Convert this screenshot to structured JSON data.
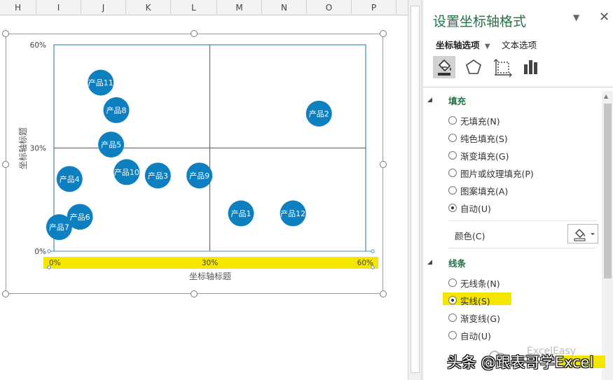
{
  "sheet": {
    "columns": [
      "H",
      "I",
      "J",
      "K",
      "L",
      "M",
      "N",
      "O",
      "P"
    ]
  },
  "chart_data": {
    "type": "bubble",
    "title": "",
    "xlabel": "坐标轴标题",
    "ylabel": "坐标轴标题",
    "xlim": [
      0,
      0.6
    ],
    "ylim": [
      0,
      0.6
    ],
    "x_ticks": [
      "0%",
      "30%",
      "60%"
    ],
    "y_ticks": [
      "0%",
      "30%",
      "60%"
    ],
    "grid": true,
    "legend": "none",
    "bubble_color": "#0e7fbf",
    "highlight_color": "#f5e600",
    "points": [
      {
        "label": "产品11",
        "x": 0.09,
        "y": 0.49
      },
      {
        "label": "产品8",
        "x": 0.12,
        "y": 0.41
      },
      {
        "label": "产品2",
        "x": 0.51,
        "y": 0.4
      },
      {
        "label": "产品5",
        "x": 0.11,
        "y": 0.31
      },
      {
        "label": "产品10",
        "x": 0.14,
        "y": 0.23
      },
      {
        "label": "产品3",
        "x": 0.2,
        "y": 0.22
      },
      {
        "label": "产品9",
        "x": 0.28,
        "y": 0.22
      },
      {
        "label": "产品4",
        "x": 0.03,
        "y": 0.21
      },
      {
        "label": "产品6",
        "x": 0.05,
        "y": 0.1
      },
      {
        "label": "产品1",
        "x": 0.36,
        "y": 0.11
      },
      {
        "label": "产品12",
        "x": 0.46,
        "y": 0.11
      },
      {
        "label": "产品7",
        "x": 0.01,
        "y": 0.07
      }
    ]
  },
  "pane": {
    "title": "设置坐标轴格式",
    "tabs": [
      "坐标轴选项",
      "文本选项"
    ],
    "icons": [
      "fill-line-icon",
      "effects-icon",
      "size-properties-icon",
      "axis-options-icon"
    ],
    "fill_section": {
      "title": "填充",
      "options": [
        "无填充(N)",
        "纯色填充(S)",
        "渐变填充(G)",
        "图片或纹理填充(P)",
        "图案填充(A)",
        "自动(U)"
      ],
      "selected": 5,
      "color_label": "颜色(C)"
    },
    "line_section": {
      "title": "线条",
      "options": [
        "无线条(N)",
        "实线(S)",
        "渐变线(G)",
        "自动(U)"
      ],
      "selected": 1
    }
  },
  "watermark": {
    "text": "头条 @跟表哥学Excel",
    "sub": "ExcelEasy"
  }
}
